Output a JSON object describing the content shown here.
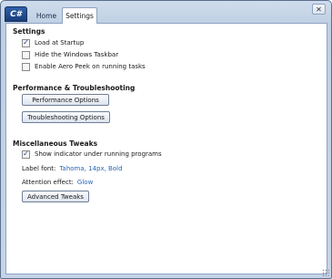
{
  "titlebar": {
    "app_logo": "C#",
    "close_glyph": "✕",
    "tabs": [
      {
        "label": "Home"
      },
      {
        "label": "Settings"
      }
    ]
  },
  "settings": {
    "title": "Settings",
    "options": [
      {
        "label": "Load at Startup",
        "checked": true
      },
      {
        "label": "Hide the Windows Taskbar",
        "checked": false
      },
      {
        "label": "Enable Aero Peek on running tasks",
        "checked": false
      }
    ]
  },
  "performance": {
    "title": "Performance & Troubleshooting",
    "performance_button": "Performance Options",
    "troubleshooting_button": "Troubleshooting Options"
  },
  "misc": {
    "title": "Miscellaneous Tweaks",
    "show_indicator": {
      "label": "Show indicator under running programs",
      "checked": true
    },
    "label_font_label": "Label font:",
    "label_font_value": "Tahoma, 14px, Bold",
    "attention_label": "Attention effect:",
    "attention_value": "Glow",
    "advanced_button": "Advanced Tweaks"
  },
  "colors": {
    "accent": "#2a66b8",
    "window_frame": "#c6d4e6"
  },
  "icons": {
    "checkmark": "✓"
  }
}
